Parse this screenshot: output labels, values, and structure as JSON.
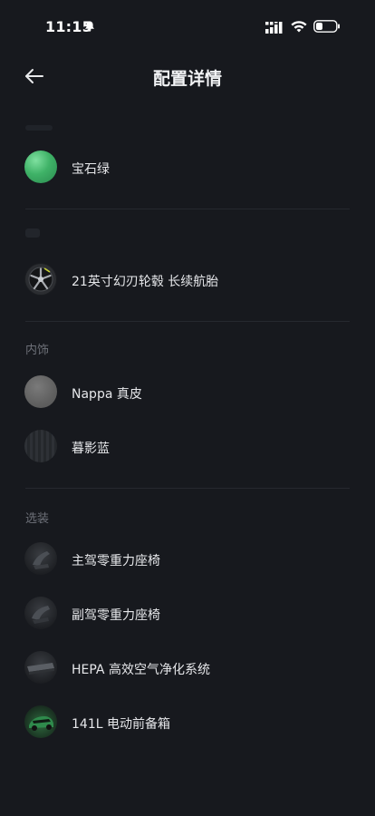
{
  "status_bar": {
    "time": "11:15"
  },
  "header": {
    "title": "配置详情"
  },
  "sections": {
    "interior_label": "内饰",
    "options_label": "选装"
  },
  "items": [
    {
      "label": "宝石绿"
    },
    {
      "label": "21英寸幻刃轮毂 长续航胎"
    },
    {
      "label": "Nappa 真皮"
    },
    {
      "label": "暮影蓝"
    },
    {
      "label": "主驾零重力座椅"
    },
    {
      "label": "副驾零重力座椅"
    },
    {
      "label": "HEPA 高效空气净化系统"
    },
    {
      "label": "141L 电动前备箱"
    }
  ]
}
